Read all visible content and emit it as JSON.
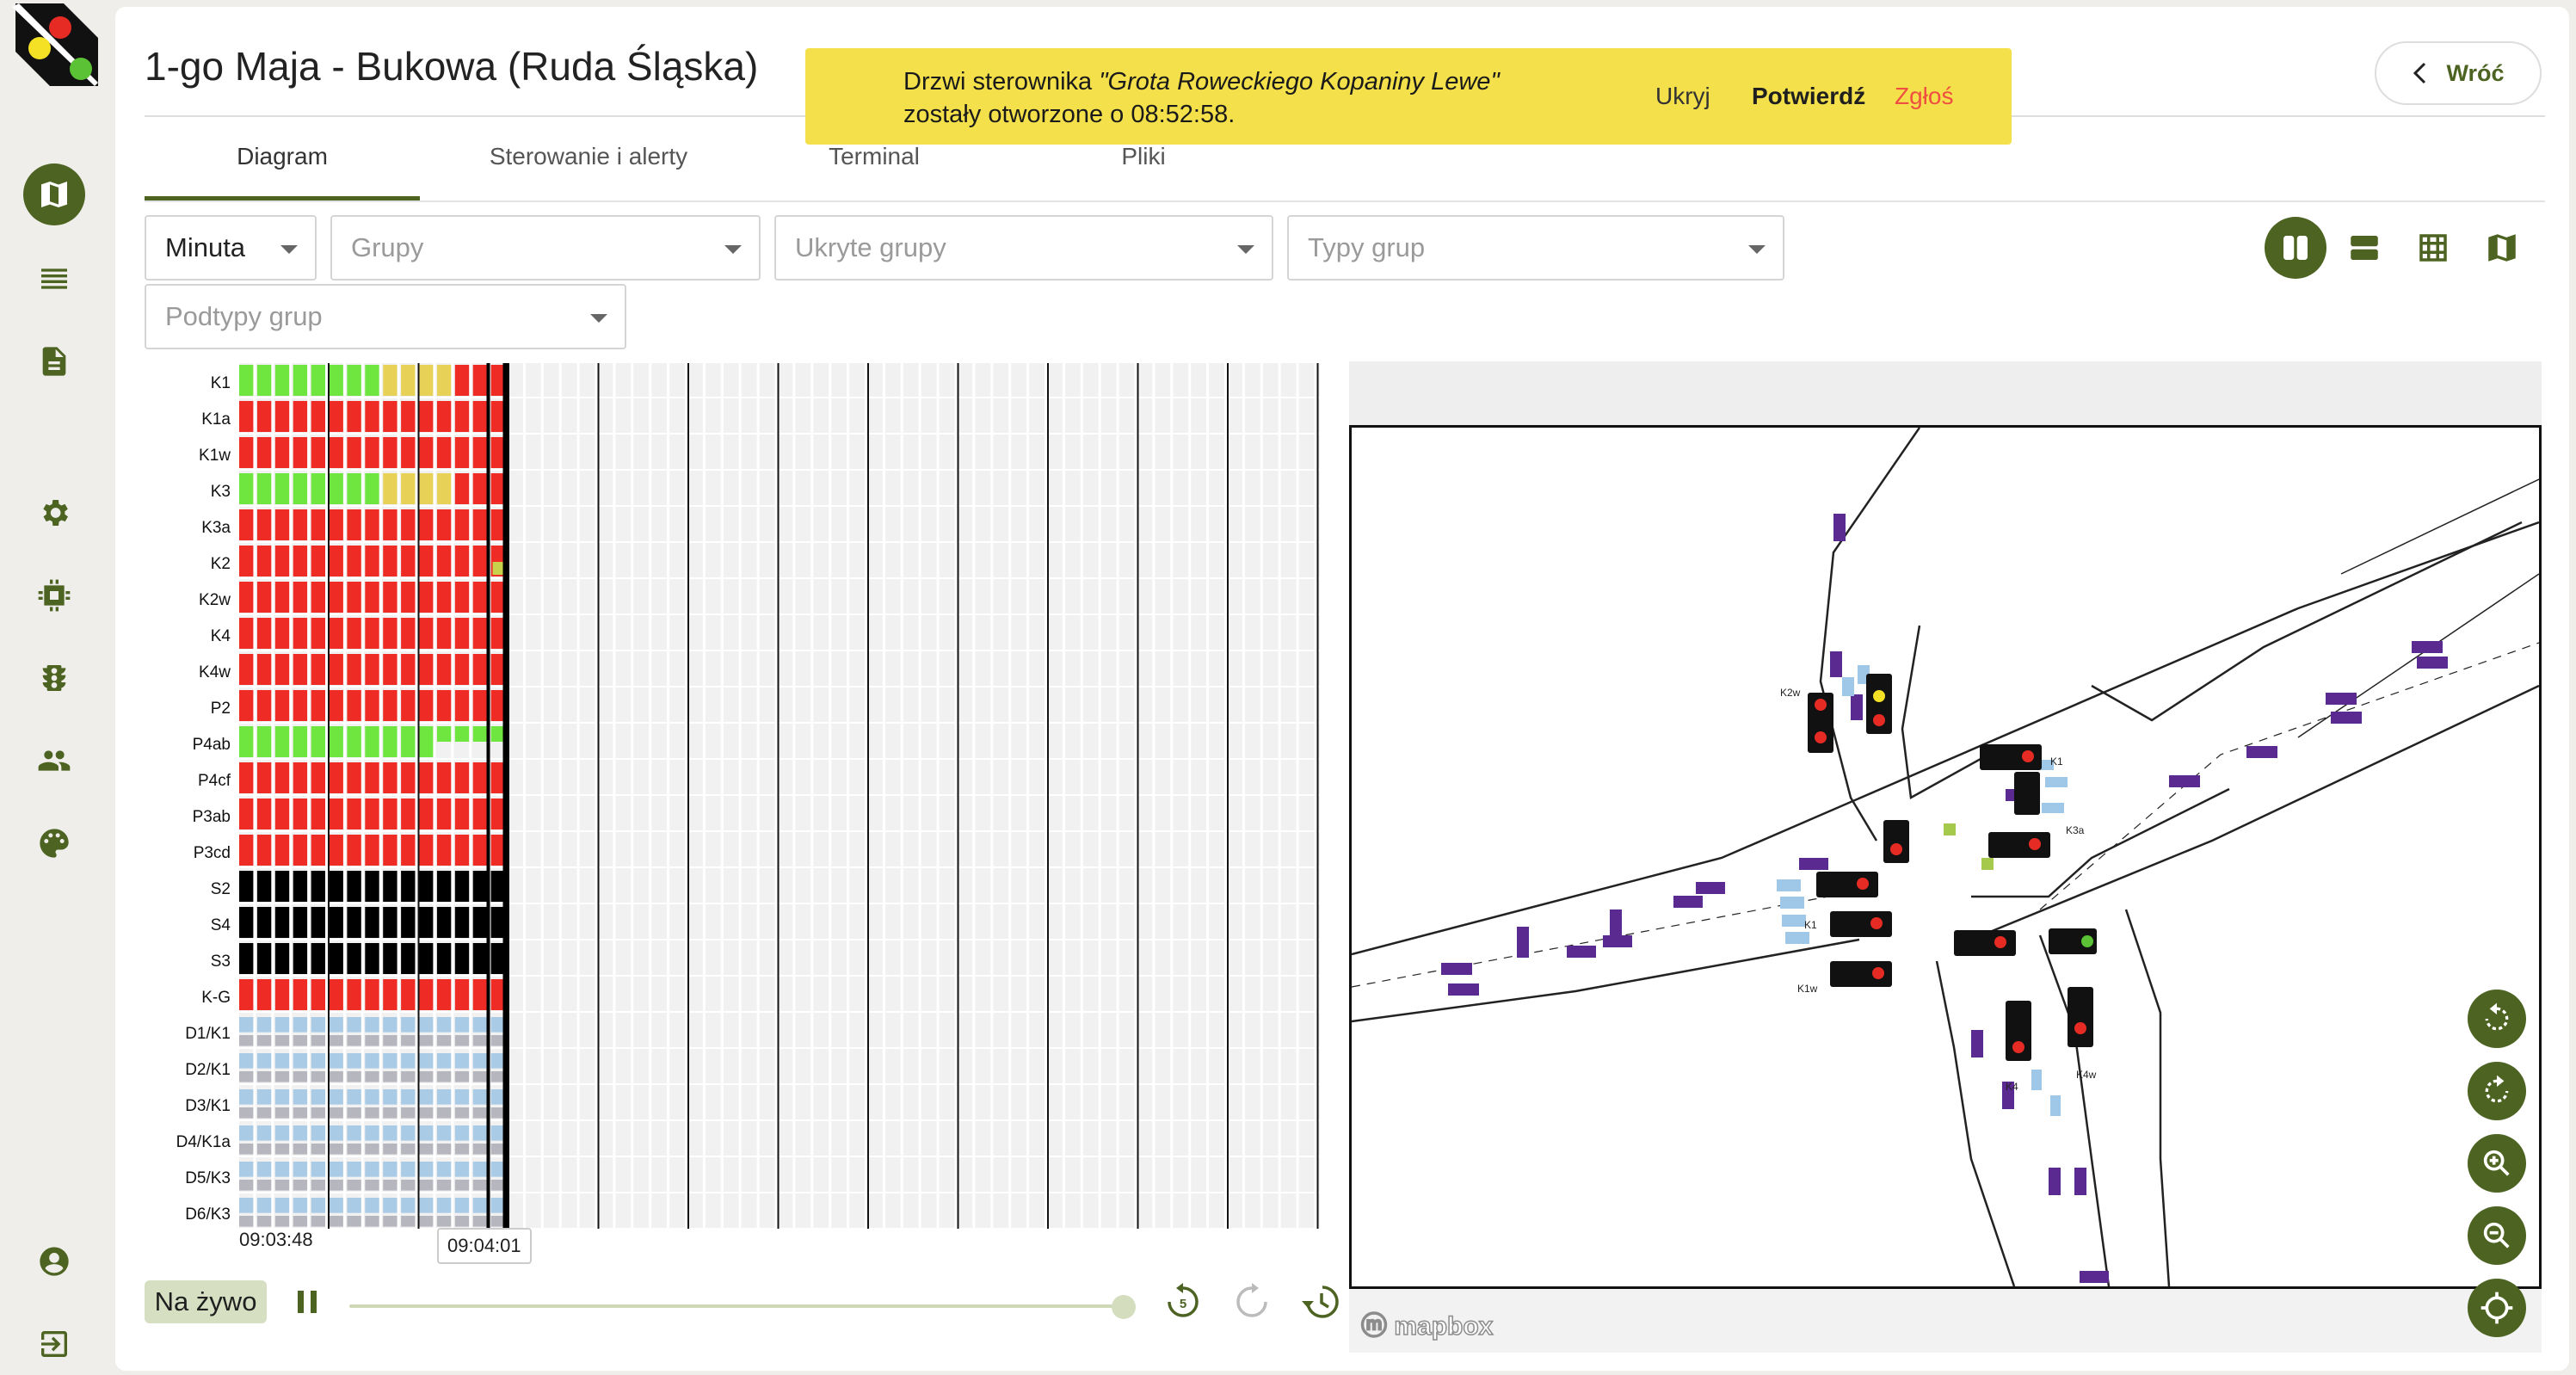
{
  "header": {
    "title": "1-go Maja - Bukowa (Ruda Śląska)",
    "back_label": "Wróć"
  },
  "alert": {
    "prefix": "Drzwi sterownika ",
    "controller": "\"Grota Roweckiego Kopaniny Lewe\"",
    "line2": "zostały otworzone o 08:52:58.",
    "hide": "Ukryj",
    "confirm": "Potwierdź",
    "report": "Zgłoś"
  },
  "tabs": [
    "Diagram",
    "Sterowanie i alerty",
    "Terminal",
    "Pliki"
  ],
  "filters": {
    "interval": "Minuta",
    "groups": "Grupy",
    "hidden_groups": "Ukryte grupy",
    "group_types": "Typy grup",
    "group_subtypes": "Podtypy grup"
  },
  "timeline": {
    "start": "09:03:48",
    "cursor": "09:04:01",
    "live_label": "Na żywo",
    "replay_seconds": "5"
  },
  "chart_data": {
    "type": "heatmap",
    "x_start": "09:03:48",
    "x_cursor": "09:04:01",
    "rows": [
      "K1",
      "K1a",
      "K1w",
      "K3",
      "K3a",
      "K2",
      "K2w",
      "K4",
      "K4w",
      "P2",
      "P4ab",
      "P4cf",
      "P3ab",
      "P3cd",
      "S2",
      "S4",
      "S3",
      "K-G",
      "D1/K1",
      "D2/K1",
      "D3/K1",
      "D4/K1a",
      "D5/K3",
      "D6/K3"
    ],
    "states": {
      "K1": [
        "green",
        "green",
        "green",
        "green",
        "green",
        "green",
        "green",
        "green",
        "yellow",
        "yellow",
        "yellow",
        "yellow",
        "red",
        "red",
        "red"
      ],
      "K1a": [
        "red",
        "red",
        "red",
        "red",
        "red",
        "red",
        "red",
        "red",
        "red",
        "red",
        "red",
        "red",
        "red",
        "red",
        "red"
      ],
      "K1w": [
        "red",
        "red",
        "red",
        "red",
        "red",
        "red",
        "red",
        "red",
        "red",
        "red",
        "red",
        "red",
        "red",
        "red",
        "red"
      ],
      "K3": [
        "green",
        "green",
        "green",
        "green",
        "green",
        "green",
        "green",
        "green",
        "yellow",
        "yellow",
        "yellow",
        "yellow",
        "red",
        "red",
        "red"
      ],
      "K3a": [
        "red",
        "red",
        "red",
        "red",
        "red",
        "red",
        "red",
        "red",
        "red",
        "red",
        "red",
        "red",
        "red",
        "red",
        "red"
      ],
      "K2": [
        "red",
        "red",
        "red",
        "red",
        "red",
        "red",
        "red",
        "red",
        "red",
        "red",
        "red",
        "red",
        "red",
        "red",
        "redyellow"
      ],
      "K2w": [
        "red",
        "red",
        "red",
        "red",
        "red",
        "red",
        "red",
        "red",
        "red",
        "red",
        "red",
        "red",
        "red",
        "red",
        "red"
      ],
      "K4": [
        "red",
        "red",
        "red",
        "red",
        "red",
        "red",
        "red",
        "red",
        "red",
        "red",
        "red",
        "red",
        "red",
        "red",
        "red"
      ],
      "K4w": [
        "red",
        "red",
        "red",
        "red",
        "red",
        "red",
        "red",
        "red",
        "red",
        "red",
        "red",
        "red",
        "red",
        "red",
        "red"
      ],
      "P2": [
        "red",
        "red",
        "red",
        "red",
        "red",
        "red",
        "red",
        "red",
        "red",
        "red",
        "red",
        "red",
        "red",
        "red",
        "red"
      ],
      "P4ab": [
        "green",
        "green",
        "green",
        "green",
        "green",
        "green",
        "green",
        "green",
        "green",
        "green",
        "green",
        "greenblink",
        "greenblink",
        "greenblink",
        "greenblink"
      ],
      "P4cf": [
        "red",
        "red",
        "red",
        "red",
        "red",
        "red",
        "red",
        "red",
        "red",
        "red",
        "red",
        "red",
        "red",
        "red",
        "red"
      ],
      "P3ab": [
        "red",
        "red",
        "red",
        "red",
        "red",
        "red",
        "red",
        "red",
        "red",
        "red",
        "red",
        "red",
        "red",
        "red",
        "red"
      ],
      "P3cd": [
        "red",
        "red",
        "red",
        "red",
        "red",
        "red",
        "red",
        "red",
        "red",
        "red",
        "red",
        "red",
        "red",
        "red",
        "red"
      ],
      "S2": [
        "black",
        "black",
        "black",
        "black",
        "black",
        "black",
        "black",
        "black",
        "black",
        "black",
        "black",
        "black",
        "black",
        "black",
        "black"
      ],
      "S4": [
        "black",
        "black",
        "black",
        "black",
        "black",
        "black",
        "black",
        "black",
        "black",
        "black",
        "black",
        "black",
        "black",
        "black",
        "black"
      ],
      "S3": [
        "black",
        "black",
        "black",
        "black",
        "black",
        "black",
        "black",
        "black",
        "black",
        "black",
        "black",
        "black",
        "black",
        "black",
        "black"
      ],
      "K-G": [
        "red",
        "red",
        "red",
        "red",
        "red",
        "red",
        "red",
        "red",
        "red",
        "red",
        "red",
        "red",
        "red",
        "red",
        "red"
      ],
      "D1/K1": [
        "detector",
        "detector",
        "detector",
        "detector",
        "detector",
        "detector",
        "detector",
        "detector",
        "detector",
        "detector",
        "detector",
        "detector",
        "detector",
        "detector",
        "detector"
      ],
      "D2/K1": [
        "detector",
        "detector",
        "detector",
        "detector",
        "detector",
        "detector",
        "detector",
        "detector",
        "detector",
        "detector",
        "detector",
        "detector",
        "detector",
        "detector",
        "detector"
      ],
      "D3/K1": [
        "detector",
        "detector",
        "detector",
        "detector",
        "detector",
        "detector",
        "detector",
        "detector",
        "detector",
        "detector",
        "detector",
        "detector",
        "detector",
        "detector",
        "detector"
      ],
      "D4/K1a": [
        "detector",
        "detector",
        "detector",
        "detector",
        "detector",
        "detector",
        "detector",
        "detector",
        "detector",
        "detector",
        "detector",
        "detector",
        "detector",
        "detector",
        "detector"
      ],
      "D5/K3": [
        "detector",
        "detector",
        "detector",
        "detector",
        "detector",
        "detector",
        "detector",
        "detector",
        "detector",
        "detector",
        "detector",
        "detector",
        "detector",
        "detector",
        "detector"
      ],
      "D6/K3": [
        "detector",
        "detector",
        "detector",
        "detector",
        "detector",
        "detector",
        "detector",
        "detector",
        "detector",
        "detector",
        "detector",
        "detector",
        "detector",
        "detector",
        "detector"
      ]
    },
    "total_columns": 60,
    "grid": true
  },
  "map": {
    "attribution": "mapbox",
    "labels": [
      "K2w",
      "K1",
      "K3a",
      "K1",
      "K1w",
      "K4",
      "K4w"
    ]
  },
  "colors": {
    "accent": "#4d6321",
    "red": "#ee2c25",
    "green": "#6fe640",
    "yellow": "#e7d257",
    "black": "#000000",
    "detector": "#a9cbe6",
    "alert_bg": "#f3e04a",
    "report": "#ef4f41"
  }
}
